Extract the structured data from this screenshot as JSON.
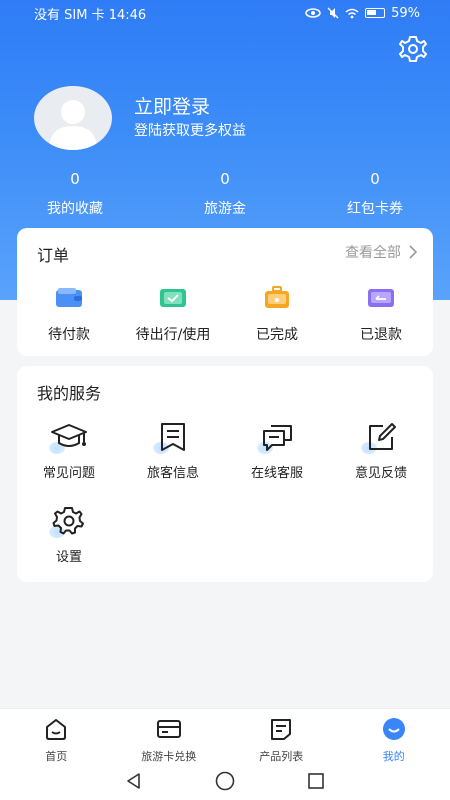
{
  "status_bar": {
    "left": "没有 SIM 卡 14:46",
    "battery": "59%"
  },
  "profile": {
    "login_title": "立即登录",
    "login_subtitle": "登陆获取更多权益"
  },
  "stats": [
    {
      "value": "0",
      "label": "我的收藏"
    },
    {
      "value": "0",
      "label": "旅游金"
    },
    {
      "value": "0",
      "label": "红包卡券"
    }
  ],
  "orders": {
    "title": "订单",
    "view_all": "查看全部",
    "items": [
      {
        "label": "待付款",
        "icon": "wallet-icon",
        "color": "#4a90f5"
      },
      {
        "label": "待出行/使用",
        "icon": "check-card-icon",
        "color": "#2ec48f"
      },
      {
        "label": "已完成",
        "icon": "luggage-icon",
        "color": "#f5a623"
      },
      {
        "label": "已退款",
        "icon": "refund-icon",
        "color": "#8a6ff0"
      }
    ]
  },
  "services": {
    "title": "我的服务",
    "items": [
      {
        "label": "常见问题",
        "icon": "graduation-cap-icon"
      },
      {
        "label": "旅客信息",
        "icon": "bookmark-icon"
      },
      {
        "label": "在线客服",
        "icon": "chat-icon"
      },
      {
        "label": "意见反馈",
        "icon": "edit-icon"
      },
      {
        "label": "设置",
        "icon": "gear-icon"
      }
    ]
  },
  "tabbar": [
    {
      "label": "首页",
      "icon": "home-icon"
    },
    {
      "label": "旅游卡兑换",
      "icon": "card-icon"
    },
    {
      "label": "产品列表",
      "icon": "list-icon"
    },
    {
      "label": "我的",
      "icon": "profile-icon"
    }
  ],
  "colors": {
    "primary": "#3a86f7",
    "background": "#f4f5f7"
  }
}
